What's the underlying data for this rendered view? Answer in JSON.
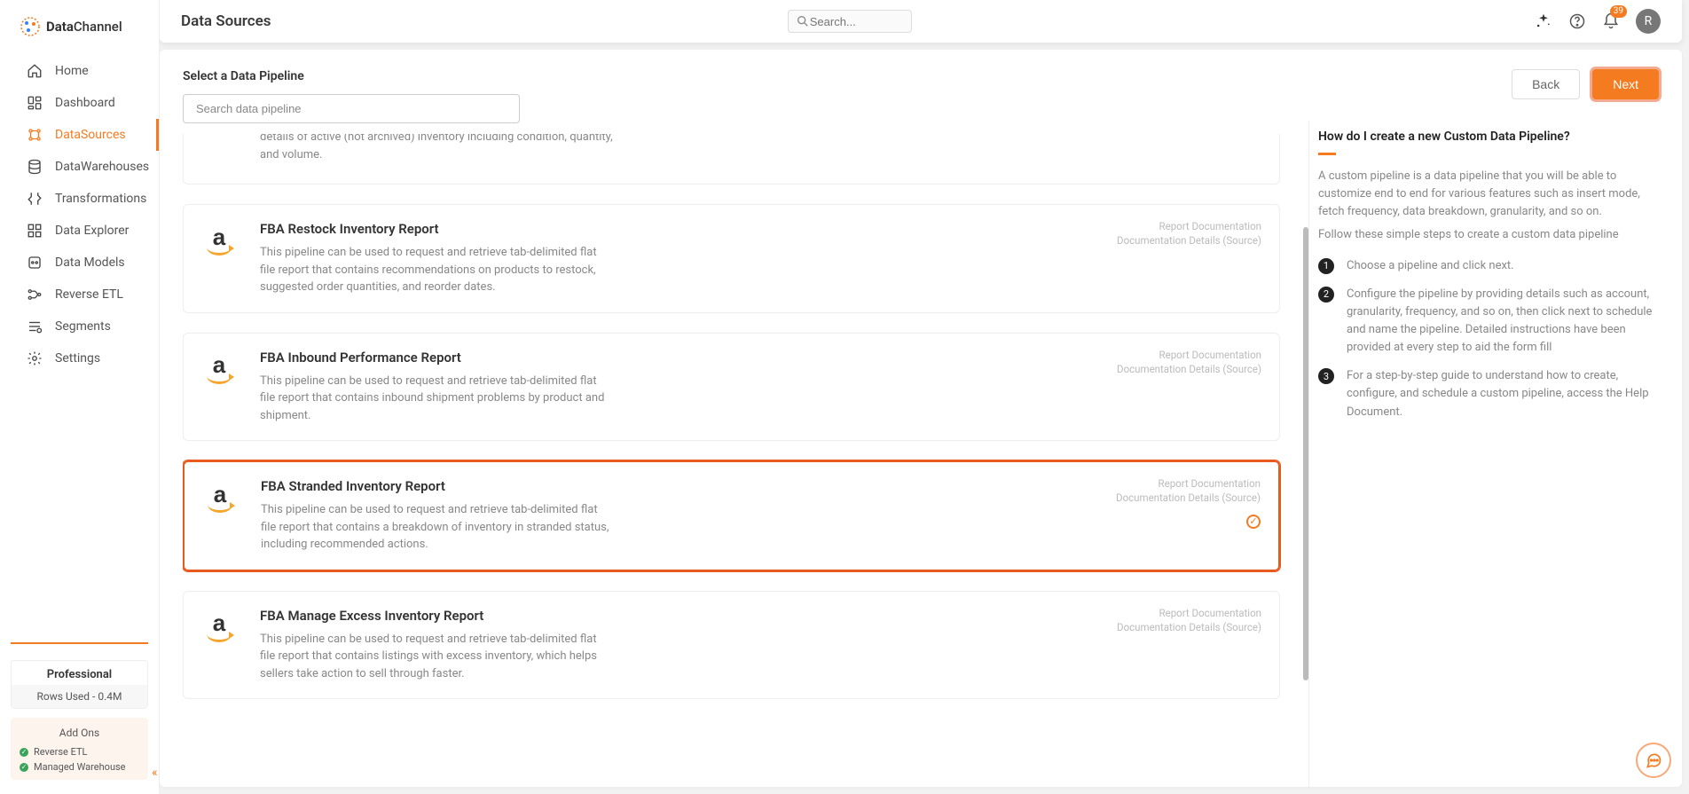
{
  "brand": {
    "name_prefix": "Data",
    "name_suffix": "Channel"
  },
  "header": {
    "title": "Data Sources",
    "search_placeholder": "Search...",
    "notifications_count": "39",
    "avatar_initial": "R"
  },
  "sidebar": {
    "items": [
      {
        "label": "Home"
      },
      {
        "label": "Dashboard"
      },
      {
        "label": "DataSources",
        "active": true
      },
      {
        "label": "DataWarehouses"
      },
      {
        "label": "Transformations"
      },
      {
        "label": "Data Explorer"
      },
      {
        "label": "Data Models"
      },
      {
        "label": "Reverse ETL"
      },
      {
        "label": "Segments"
      },
      {
        "label": "Settings"
      }
    ],
    "plan": {
      "tier": "Professional",
      "rows_used": "Rows Used - 0.4M",
      "addons_title": "Add Ons",
      "addons": [
        "Reverse ETL",
        "Managed Warehouse"
      ]
    }
  },
  "wizard": {
    "section_title": "Select a Data Pipeline",
    "search_placeholder": "Search data pipeline",
    "back_label": "Back",
    "next_label": "Next"
  },
  "pipelines": {
    "doc_link_1": "Report Documentation",
    "doc_link_2": "Documentation Details (Source)",
    "items": [
      {
        "id": "truncated",
        "title": "",
        "desc_fragment": "details of active (not archived) inventory including condition, quantity, and volume."
      },
      {
        "id": "restock",
        "title": "FBA Restock Inventory Report",
        "desc": "This pipeline can be used to request and retrieve tab-delimited flat file report that contains recommendations on products to restock, suggested order quantities, and reorder dates."
      },
      {
        "id": "inbound",
        "title": "FBA Inbound Performance Report",
        "desc": "This pipeline can be used to request and retrieve tab-delimited flat file report that contains inbound shipment problems by product and shipment."
      },
      {
        "id": "stranded",
        "title": "FBA Stranded Inventory Report",
        "desc": "This pipeline can be used to request and retrieve tab-delimited flat file report that contains a breakdown of inventory in stranded status, including recommended actions.",
        "selected": true
      },
      {
        "id": "excess",
        "title": "FBA Manage Excess Inventory Report",
        "desc": "This pipeline can be used to request and retrieve tab-delimited flat file report that contains listings with excess inventory, which helps sellers take action to sell through faster."
      }
    ]
  },
  "help": {
    "title": "How do I create a new Custom Data Pipeline?",
    "intro_1": "A custom pipeline is a data pipeline that you will be able to customize end to end for various features such as insert mode, fetch frequency, data breakdown, granularity, and so on.",
    "intro_2": "Follow these simple steps to create a custom data pipeline",
    "steps": [
      "Choose a pipeline and click next.",
      "Configure the pipeline by providing details such as account, granularity, frequency, and so on, then click next to schedule and name the pipeline. Detailed instructions have been provided at every step to aid the form fill",
      "For a step-by-step guide to understand how to create, configure, and schedule a custom pipeline, access the Help Document."
    ]
  }
}
